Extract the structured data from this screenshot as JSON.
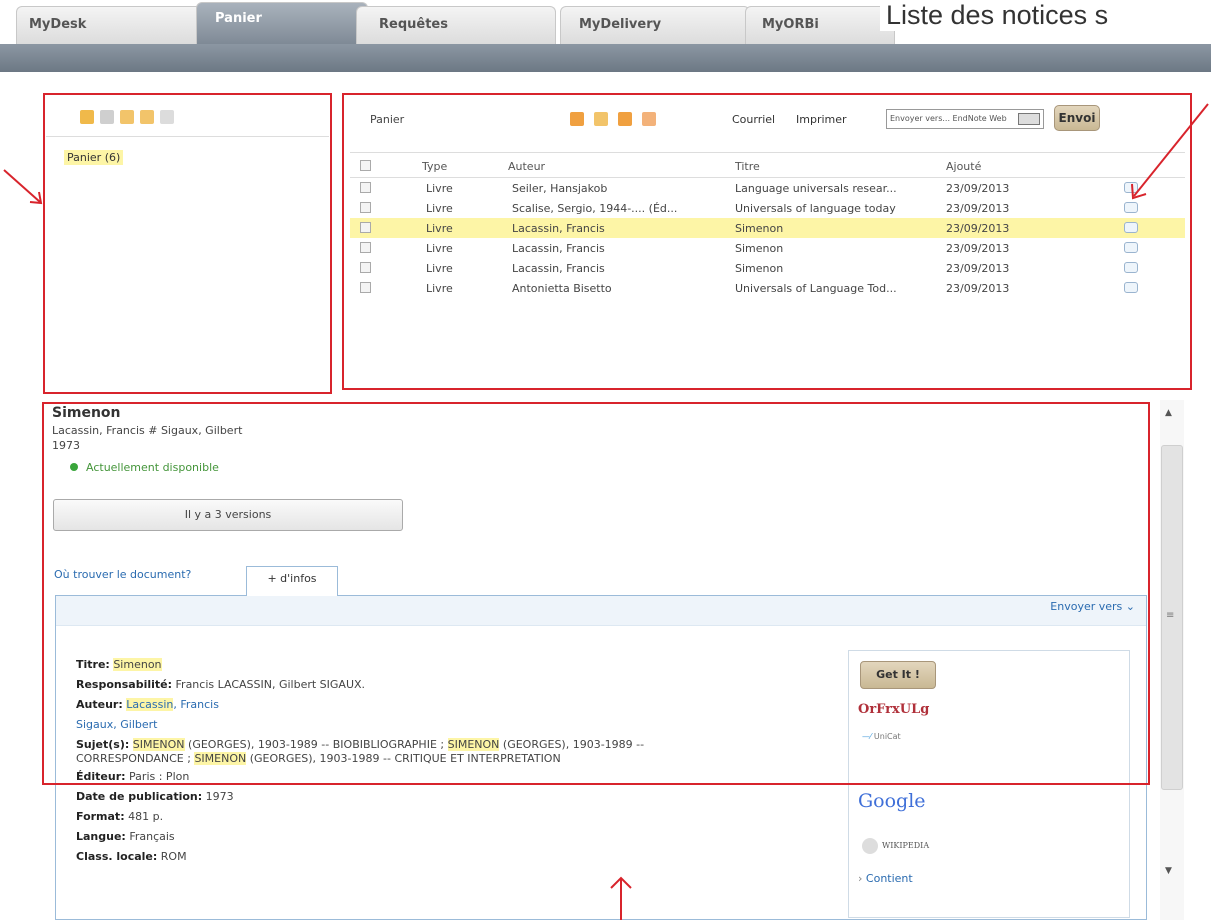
{
  "tabs": [
    "MyDesk",
    "Panier",
    "Requêtes",
    "MyDelivery",
    "MyORBi"
  ],
  "headline": "Liste des notices s",
  "left": {
    "basket_label": "Panier (6)"
  },
  "basket": {
    "label": "Panier",
    "courriel": "Courriel",
    "imprimer": "Imprimer",
    "send_select": "Envoyer vers... EndNote Web",
    "envoi": "Envoi",
    "columns": [
      "Type",
      "Auteur",
      "Titre",
      "Ajouté"
    ],
    "rows": [
      [
        "Livre",
        "Seiler, Hansjakob",
        "Language universals resear...",
        "23/09/2013"
      ],
      [
        "Livre",
        "Scalise, Sergio, 1944-.... (Éd...",
        "Universals of language today",
        "23/09/2013"
      ],
      [
        "Livre",
        "Lacassin, Francis",
        "Simenon",
        "23/09/2013"
      ],
      [
        "Livre",
        "Lacassin, Francis",
        "Simenon",
        "23/09/2013"
      ],
      [
        "Livre",
        "Lacassin, Francis",
        "Simenon",
        "23/09/2013"
      ],
      [
        "Livre",
        "Antonietta Bisetto",
        "Universals of Language Tod...",
        "23/09/2013"
      ]
    ]
  },
  "detail": {
    "title": "Simenon",
    "authors": "Lacassin, Francis # Sigaux, Gilbert",
    "year": "1973",
    "availability": "Actuellement disponible",
    "versions": "Il y a 3 versions",
    "where": "Où trouver le document?",
    "more_tab": "+ d'infos",
    "send_to": "Envoyer vers",
    "f_titre_k": "Titre:",
    "f_titre_v": "Simenon",
    "f_resp_k": "Responsabilité:",
    "f_resp_v": "Francis LACASSIN, Gilbert SIGAUX.",
    "f_auteur_k": "Auteur:",
    "f_auteur_hl": "Lacassin",
    "f_auteur_rest": ", Francis",
    "f_auteur2": "Sigaux, Gilbert",
    "f_sujet_k": "Sujet(s):",
    "f_sujet_l1a": "SIMENON",
    "f_sujet_l1b": " (GEORGES), 1903-1989 -- BIOBIBLIOGRAPHIE ; ",
    "f_sujet_l1c": "SIMENON",
    "f_sujet_l1d": " (GEORGES), 1903-1989 --",
    "f_sujet_l2a": "CORRESPONDANCE ; ",
    "f_sujet_l2b": "SIMENON",
    "f_sujet_l2c": " (GEORGES), 1903-1989 -- CRITIQUE ET INTERPRETATION",
    "f_editeur_k": "Éditeur:",
    "f_editeur_v": "Paris : Plon",
    "f_date_k": "Date de publication:",
    "f_date_v": "1973",
    "f_format_k": "Format:",
    "f_format_v": "481 p.",
    "f_langue_k": "Langue:",
    "f_langue_v": "Français",
    "f_class_k": "Class. locale:",
    "f_class_v": "ROM",
    "getit": "Get It !",
    "orbi_logo": "OrFrxULg",
    "unicat_logo": "UniCat",
    "google_logo": "Google",
    "wiki_logo": "WIKIPEDIA",
    "contient": "Contient"
  },
  "colors": {
    "accent": "#d8242c",
    "highlight": "#fdf5a6",
    "link": "#2a6bb0"
  }
}
